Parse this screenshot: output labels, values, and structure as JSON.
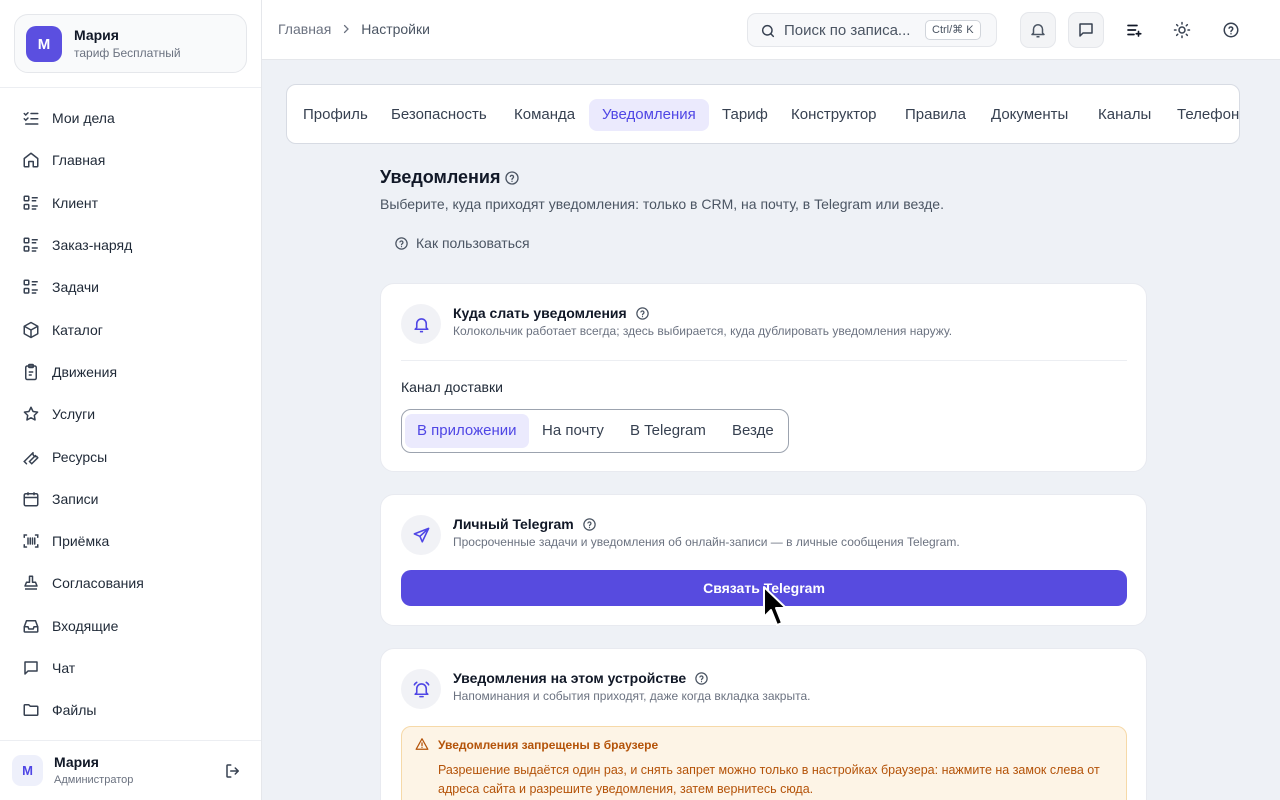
{
  "workspace": {
    "avatar": "М",
    "name": "Мария",
    "plan": "тариф Бесплатный"
  },
  "sidebar": {
    "items": [
      {
        "label": "Мои дела",
        "icon": "list-check-icon"
      },
      {
        "label": "Главная",
        "icon": "home-icon"
      },
      {
        "label": "Клиент",
        "icon": "list-icon"
      },
      {
        "label": "Заказ-наряд",
        "icon": "list-icon"
      },
      {
        "label": "Задачи",
        "icon": "list-icon"
      },
      {
        "label": "Каталог",
        "icon": "box-icon"
      },
      {
        "label": "Движения",
        "icon": "clipboard-icon"
      },
      {
        "label": "Услуги",
        "icon": "star-icon"
      },
      {
        "label": "Ресурсы",
        "icon": "wrench-icon"
      },
      {
        "label": "Записи",
        "icon": "calendar-icon"
      },
      {
        "label": "Приёмка",
        "icon": "scan-icon"
      },
      {
        "label": "Согласования",
        "icon": "stamp-icon"
      },
      {
        "label": "Входящие",
        "icon": "inbox-icon"
      },
      {
        "label": "Чат",
        "icon": "chat-icon"
      },
      {
        "label": "Файлы",
        "icon": "folder-icon"
      }
    ]
  },
  "user": {
    "avatar": "М",
    "name": "Мария",
    "role": "Администратор"
  },
  "breadcrumb": {
    "home": "Главная",
    "current": "Настройки"
  },
  "search": {
    "placeholder": "Поиск по записям...",
    "placeholder_shown": "Поиск по записа...",
    "shortcut": "Ctrl/⌘ K"
  },
  "tabs": [
    "Профиль",
    "Безопасность",
    "Команда",
    "Уведомления",
    "Тариф",
    "Конструктор",
    "Правила",
    "Документы",
    "Каналы",
    "Телефония"
  ],
  "active_tab": "Уведомления",
  "page": {
    "title": "Уведомления",
    "subtitle": "Выберите, куда приходят уведомления: только в CRM, на почту, в Telegram или везде.",
    "howto": "Как пользоваться"
  },
  "delivery_card": {
    "title": "Куда слать уведомления",
    "desc": "Колокольчик работает всегда; здесь выбирается, куда дублировать уведомления наружу.",
    "channel_label": "Канал доставки",
    "options": [
      "В приложении",
      "На почту",
      "В Telegram",
      "Везде"
    ],
    "selected": "В приложении"
  },
  "telegram_card": {
    "title": "Личный Telegram",
    "desc": "Просроченные задачи и уведомления об онлайн-записи — в личные сообщения Telegram.",
    "button": "Связать Telegram"
  },
  "device_card": {
    "title": "Уведомления на этом устройстве",
    "desc": "Напоминания и события приходят, даже когда вкладка закрыта.",
    "alert_title": "Уведомления запрещены в браузере",
    "alert_text": "Разрешение выдаётся один раз, и снять запрет можно только в настройках браузера: нажмите на замок слева от адреса сайта и разрешите уведомления, затем вернитесь сюда."
  },
  "colors": {
    "accent": "#574bdf",
    "accent_soft": "#ebeafd",
    "warning_bg": "#fdf4e6",
    "warning_text": "#b45309"
  }
}
